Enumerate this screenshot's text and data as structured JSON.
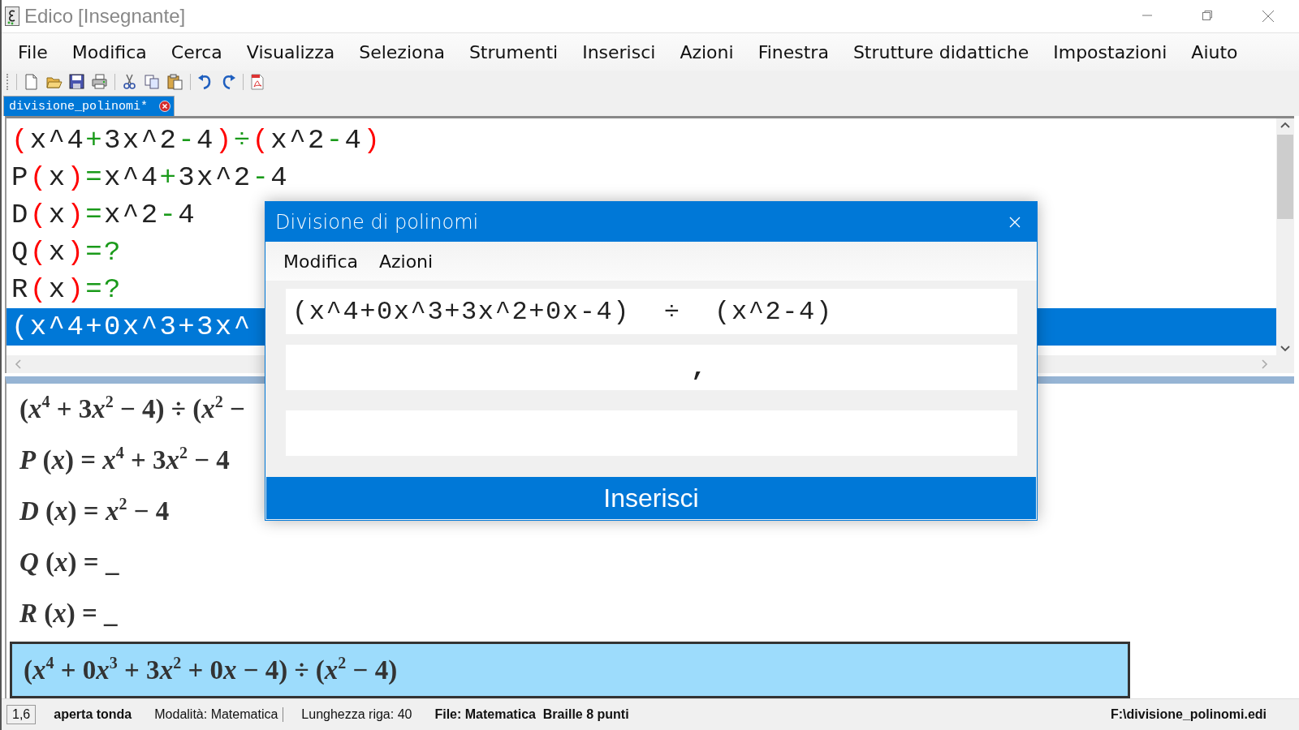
{
  "window": {
    "title": "Edico",
    "role": "[Insegnante]"
  },
  "menu": [
    "File",
    "Modifica",
    "Cerca",
    "Visualizza",
    "Seleziona",
    "Strumenti",
    "Inserisci",
    "Azioni",
    "Finestra",
    "Strutture didattiche",
    "Impostazioni",
    "Aiuto"
  ],
  "tabs": [
    {
      "label": "divisione_polinomi*",
      "selected": true
    }
  ],
  "editor": {
    "lines": [
      {
        "selected": false,
        "tokens": [
          {
            "kind": "paren",
            "text": "("
          },
          {
            "kind": "text",
            "text": "x^4"
          },
          {
            "kind": "op",
            "text": "+"
          },
          {
            "kind": "text",
            "text": "3x^2"
          },
          {
            "kind": "op",
            "text": "-"
          },
          {
            "kind": "text",
            "text": "4"
          },
          {
            "kind": "paren",
            "text": ")"
          },
          {
            "kind": "op",
            "text": "÷"
          },
          {
            "kind": "paren",
            "text": "("
          },
          {
            "kind": "text",
            "text": "x^2"
          },
          {
            "kind": "op",
            "text": "-"
          },
          {
            "kind": "text",
            "text": "4"
          },
          {
            "kind": "paren",
            "text": ")"
          }
        ]
      },
      {
        "selected": false,
        "tokens": [
          {
            "kind": "text",
            "text": "P"
          },
          {
            "kind": "paren",
            "text": "("
          },
          {
            "kind": "text",
            "text": "x"
          },
          {
            "kind": "paren",
            "text": ")"
          },
          {
            "kind": "op",
            "text": "="
          },
          {
            "kind": "text",
            "text": "x^4"
          },
          {
            "kind": "op",
            "text": "+"
          },
          {
            "kind": "text",
            "text": "3x^2"
          },
          {
            "kind": "op",
            "text": "-"
          },
          {
            "kind": "text",
            "text": "4"
          }
        ]
      },
      {
        "selected": false,
        "tokens": [
          {
            "kind": "text",
            "text": "D"
          },
          {
            "kind": "paren",
            "text": "("
          },
          {
            "kind": "text",
            "text": "x"
          },
          {
            "kind": "paren",
            "text": ")"
          },
          {
            "kind": "op",
            "text": "="
          },
          {
            "kind": "text",
            "text": "x^2"
          },
          {
            "kind": "op",
            "text": "-"
          },
          {
            "kind": "text",
            "text": "4"
          }
        ]
      },
      {
        "selected": false,
        "tokens": [
          {
            "kind": "text",
            "text": "Q"
          },
          {
            "kind": "paren",
            "text": "("
          },
          {
            "kind": "text",
            "text": "x"
          },
          {
            "kind": "paren",
            "text": ")"
          },
          {
            "kind": "op",
            "text": "=?"
          }
        ]
      },
      {
        "selected": false,
        "tokens": [
          {
            "kind": "text",
            "text": "R"
          },
          {
            "kind": "paren",
            "text": "("
          },
          {
            "kind": "text",
            "text": "x"
          },
          {
            "kind": "paren",
            "text": ")"
          },
          {
            "kind": "op",
            "text": "=?"
          }
        ]
      },
      {
        "selected": true,
        "tokens": [
          {
            "kind": "paren",
            "text": "("
          },
          {
            "kind": "text",
            "text": "x^4+0x^3+3x^"
          }
        ]
      }
    ]
  },
  "preview": {
    "lines": [
      {
        "selected": false,
        "text": "(x$^{4}$ + 3x$^{2}$ − 4) ÷ (x$^{2}$ −"
      },
      {
        "selected": false,
        "text": "P (x) = x$^{4}$ + 3x$^{2}$ − 4"
      },
      {
        "selected": false,
        "text": "D (x) = x$^{2}$ − 4"
      },
      {
        "selected": false,
        "text": "Q (x) = _"
      },
      {
        "selected": false,
        "text": "R (x) = _"
      },
      {
        "selected": true,
        "text": "(x$^{4}$ + 0x$^{3}$ + 3x$^{2}$ + 0x − 4) ÷ (x$^{2}$ − 4)"
      }
    ]
  },
  "dialog": {
    "title": "Divisione di polinomi",
    "menu": [
      "Modifica",
      "Azioni"
    ],
    "fields": [
      {
        "value": "(x^4+0x^3+3x^2+0x-4)  ÷  (x^2-4)"
      },
      {
        "value": ","
      }
    ],
    "button": "Inserisci"
  },
  "status_bar": [
    {
      "kind": "position",
      "text": "1,6"
    },
    {
      "kind": "strong",
      "text": "aperta tonda"
    },
    {
      "kind": "field",
      "text": "Modalità: Matematica"
    },
    {
      "kind": "plain",
      "text": "Lunghezza riga: 40"
    },
    {
      "kind": "strong",
      "text": "File: Matematica  Braille 8 punti"
    },
    {
      "kind": "path",
      "text": "F:\\divisione_polinomi.edi"
    }
  ]
}
